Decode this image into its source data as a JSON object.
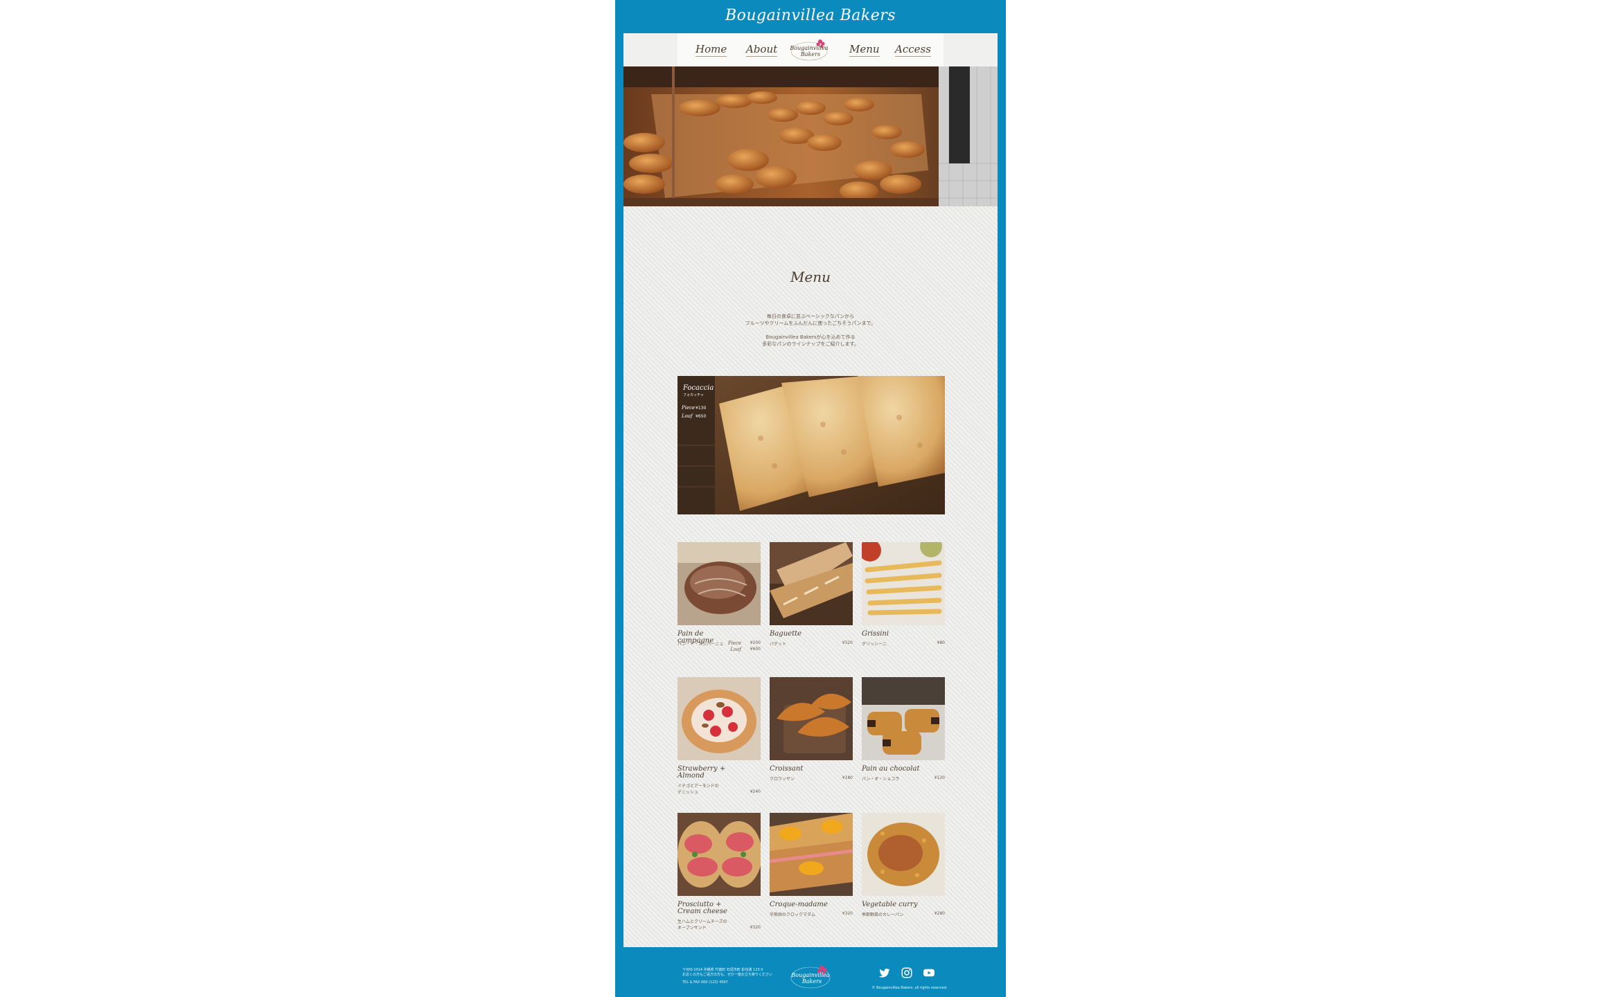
{
  "site": {
    "title": "Bougainvillea Bakers"
  },
  "nav": {
    "items": [
      {
        "label": "Home"
      },
      {
        "label": "About"
      },
      {
        "label": "Menu"
      },
      {
        "label": "Access"
      }
    ],
    "logo_line1": "Bougainvillea",
    "logo_line2": "Bakers"
  },
  "menu": {
    "heading": "Menu",
    "intro": [
      [
        "毎日の食卓に並ぶベーシックなパンから",
        "フルーツやクリームをふんだんに使ったごちそうパンまで。"
      ],
      [
        "Bougainvillea Bakersが心を込めて作る",
        "多彩なパンのラインナップをご紹介します。"
      ]
    ]
  },
  "featured": {
    "name": "Focaccia",
    "jp": "フォカッチャ",
    "price_piece_label": "Piece",
    "price_piece": "¥130",
    "price_loaf_label": "Loaf",
    "price_loaf": "¥650"
  },
  "items": [
    {
      "name": "Pain de campagne",
      "jp": [
        "パン・ド・カンパーニュ"
      ],
      "price_piece_label": "Piece",
      "price": "¥200",
      "price_loaf_label": "Loaf",
      "price2": "¥600"
    },
    {
      "name": "Baguette",
      "jp": [
        "バゲット"
      ],
      "price": "¥320"
    },
    {
      "name": "Grissini",
      "jp": [
        "グリッシーニ"
      ],
      "price": "¥80"
    },
    {
      "name": "Strawberry + Almond",
      "jp": [
        "イチゴとアーモンドの",
        "デニッシュ"
      ],
      "price": "¥240"
    },
    {
      "name": "Croissant",
      "jp": [
        "クロワッサン"
      ],
      "price": "¥180"
    },
    {
      "name": "Pain au chocolat",
      "jp": [
        "パン・オ・ショコラ"
      ],
      "price": "¥120"
    },
    {
      "name": "Prosciutto + Cream cheese",
      "jp": [
        "生ハムとクリームチーズの",
        "オープンサンド"
      ],
      "price": "¥320"
    },
    {
      "name": "Croque-madame",
      "jp": [
        "半熟卵のクロックマダム"
      ],
      "price": "¥320"
    },
    {
      "name": "Vegetable curry",
      "jp": [
        "季節野菜のカレーパン"
      ],
      "price": "¥280"
    }
  ],
  "footer": {
    "address_lines": [
      "〒000-1014 沖縄県 竹富町 石垣市町 彩花通 123-5",
      "お近くの方もご遠方の方も、ぜひ一度お立ち寄りください",
      "TEL & FAX 000 (123) 4567"
    ],
    "copyright": "© Bougainvillea Bakers. all rights reserved.",
    "social": [
      {
        "icon": "twitter-icon"
      },
      {
        "icon": "instagram-icon"
      },
      {
        "icon": "youtube-icon"
      }
    ]
  },
  "colors": {
    "brand_blue": "#0b8bbd",
    "text_brown": "#4b3b2d",
    "logo_pink": "#d8407a"
  }
}
